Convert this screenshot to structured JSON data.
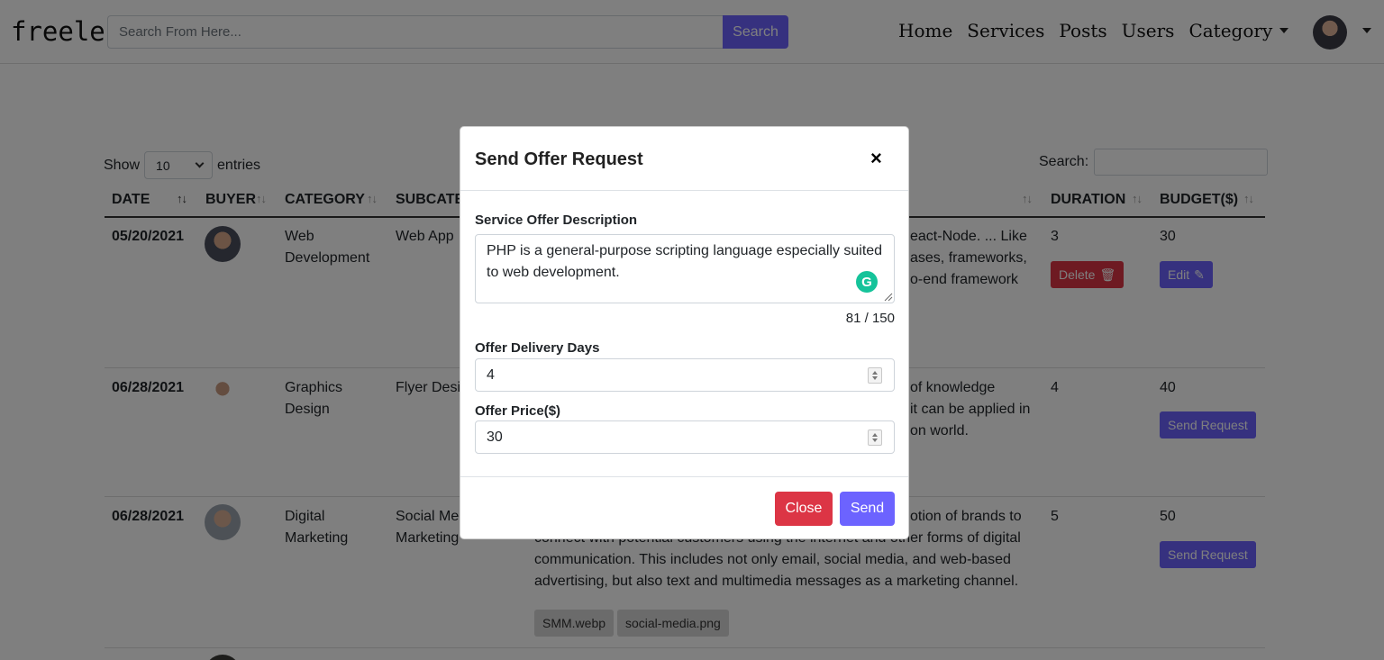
{
  "navbar": {
    "brand": "freele",
    "search_placeholder": "Search From Here...",
    "search_button": "Search",
    "links": [
      "Home",
      "Services",
      "Posts",
      "Users",
      "Category"
    ]
  },
  "table_controls": {
    "show_label": "Show",
    "entries_value": "10",
    "entries_label": "entries",
    "search_label": "Search:"
  },
  "table": {
    "headers": [
      "DATE",
      "BUYER",
      "CATEGORY",
      "SUBCATE",
      "DURATION",
      "BUDGET($)"
    ],
    "rows": [
      {
        "date": "05/20/2021",
        "category_line1": "Web",
        "category_line2": "Development",
        "subcategory": "Web App",
        "desc_lines": [
          "eact-Node. ... Like",
          "ases, frameworks,",
          "o-end framework"
        ],
        "duration": "3",
        "budget": "30",
        "action1": "Delete",
        "action2": "Edit"
      },
      {
        "date": "06/28/2021",
        "category_line1": "Graphics",
        "category_line2": "Design",
        "subcategory": "Flyer Desig",
        "desc_lines": [
          "of knowledge",
          " it can be applied in",
          "on world."
        ],
        "duration": "4",
        "budget": "40",
        "action": "Send Request"
      },
      {
        "date": "06/28/2021",
        "category_line1": "Digital",
        "category_line2": "Marketing",
        "subcategory_line1": "Social Med",
        "subcategory_line2": "Marketing",
        "desc_lines": [
          "otion of brands to",
          "connect with potential customers using the internet and other forms of digital",
          "communication. This includes not only email, social media, and web-based",
          "advertising, but also text and multimedia messages as a marketing channel."
        ],
        "files": [
          "SMM.webp",
          "social-media.png"
        ],
        "duration": "5",
        "budget": "50",
        "action": "Send Request"
      }
    ]
  },
  "modal": {
    "title": "Send Offer Request",
    "close_x": "×",
    "description_label": "Service Offer Description",
    "description_value": "PHP is a general-purpose scripting language especially suited to web development.",
    "char_counter": "81 / 150",
    "days_label": "Offer Delivery Days",
    "days_value": "4",
    "price_label": "Offer Price($)",
    "price_value": "30",
    "close_button": "Close",
    "send_button": "Send"
  },
  "colors": {
    "primary": "#6c63ff",
    "danger": "#dc3545",
    "overlay": "rgba(0,0,0,0.5)"
  }
}
